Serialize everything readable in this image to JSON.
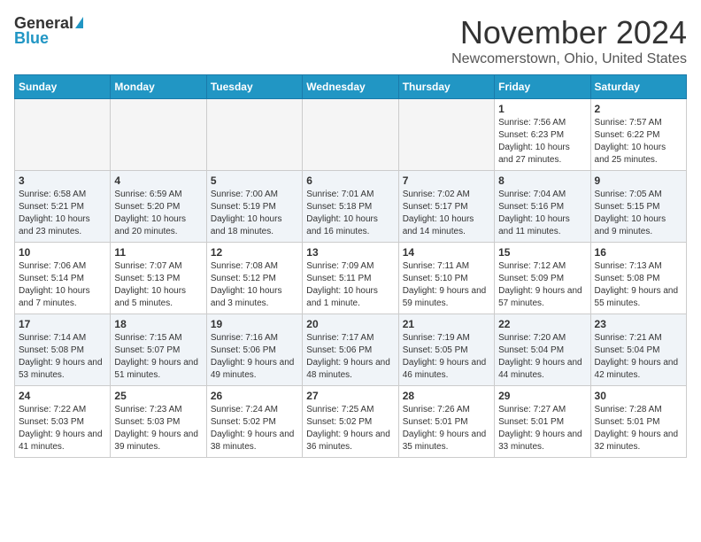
{
  "header": {
    "logo_general": "General",
    "logo_blue": "Blue",
    "month": "November 2024",
    "location": "Newcomerstown, Ohio, United States"
  },
  "days_of_week": [
    "Sunday",
    "Monday",
    "Tuesday",
    "Wednesday",
    "Thursday",
    "Friday",
    "Saturday"
  ],
  "weeks": [
    [
      {
        "day": "",
        "info": ""
      },
      {
        "day": "",
        "info": ""
      },
      {
        "day": "",
        "info": ""
      },
      {
        "day": "",
        "info": ""
      },
      {
        "day": "",
        "info": ""
      },
      {
        "day": "1",
        "info": "Sunrise: 7:56 AM\nSunset: 6:23 PM\nDaylight: 10 hours and 27 minutes."
      },
      {
        "day": "2",
        "info": "Sunrise: 7:57 AM\nSunset: 6:22 PM\nDaylight: 10 hours and 25 minutes."
      }
    ],
    [
      {
        "day": "3",
        "info": "Sunrise: 6:58 AM\nSunset: 5:21 PM\nDaylight: 10 hours and 23 minutes."
      },
      {
        "day": "4",
        "info": "Sunrise: 6:59 AM\nSunset: 5:20 PM\nDaylight: 10 hours and 20 minutes."
      },
      {
        "day": "5",
        "info": "Sunrise: 7:00 AM\nSunset: 5:19 PM\nDaylight: 10 hours and 18 minutes."
      },
      {
        "day": "6",
        "info": "Sunrise: 7:01 AM\nSunset: 5:18 PM\nDaylight: 10 hours and 16 minutes."
      },
      {
        "day": "7",
        "info": "Sunrise: 7:02 AM\nSunset: 5:17 PM\nDaylight: 10 hours and 14 minutes."
      },
      {
        "day": "8",
        "info": "Sunrise: 7:04 AM\nSunset: 5:16 PM\nDaylight: 10 hours and 11 minutes."
      },
      {
        "day": "9",
        "info": "Sunrise: 7:05 AM\nSunset: 5:15 PM\nDaylight: 10 hours and 9 minutes."
      }
    ],
    [
      {
        "day": "10",
        "info": "Sunrise: 7:06 AM\nSunset: 5:14 PM\nDaylight: 10 hours and 7 minutes."
      },
      {
        "day": "11",
        "info": "Sunrise: 7:07 AM\nSunset: 5:13 PM\nDaylight: 10 hours and 5 minutes."
      },
      {
        "day": "12",
        "info": "Sunrise: 7:08 AM\nSunset: 5:12 PM\nDaylight: 10 hours and 3 minutes."
      },
      {
        "day": "13",
        "info": "Sunrise: 7:09 AM\nSunset: 5:11 PM\nDaylight: 10 hours and 1 minute."
      },
      {
        "day": "14",
        "info": "Sunrise: 7:11 AM\nSunset: 5:10 PM\nDaylight: 9 hours and 59 minutes."
      },
      {
        "day": "15",
        "info": "Sunrise: 7:12 AM\nSunset: 5:09 PM\nDaylight: 9 hours and 57 minutes."
      },
      {
        "day": "16",
        "info": "Sunrise: 7:13 AM\nSunset: 5:08 PM\nDaylight: 9 hours and 55 minutes."
      }
    ],
    [
      {
        "day": "17",
        "info": "Sunrise: 7:14 AM\nSunset: 5:08 PM\nDaylight: 9 hours and 53 minutes."
      },
      {
        "day": "18",
        "info": "Sunrise: 7:15 AM\nSunset: 5:07 PM\nDaylight: 9 hours and 51 minutes."
      },
      {
        "day": "19",
        "info": "Sunrise: 7:16 AM\nSunset: 5:06 PM\nDaylight: 9 hours and 49 minutes."
      },
      {
        "day": "20",
        "info": "Sunrise: 7:17 AM\nSunset: 5:06 PM\nDaylight: 9 hours and 48 minutes."
      },
      {
        "day": "21",
        "info": "Sunrise: 7:19 AM\nSunset: 5:05 PM\nDaylight: 9 hours and 46 minutes."
      },
      {
        "day": "22",
        "info": "Sunrise: 7:20 AM\nSunset: 5:04 PM\nDaylight: 9 hours and 44 minutes."
      },
      {
        "day": "23",
        "info": "Sunrise: 7:21 AM\nSunset: 5:04 PM\nDaylight: 9 hours and 42 minutes."
      }
    ],
    [
      {
        "day": "24",
        "info": "Sunrise: 7:22 AM\nSunset: 5:03 PM\nDaylight: 9 hours and 41 minutes."
      },
      {
        "day": "25",
        "info": "Sunrise: 7:23 AM\nSunset: 5:03 PM\nDaylight: 9 hours and 39 minutes."
      },
      {
        "day": "26",
        "info": "Sunrise: 7:24 AM\nSunset: 5:02 PM\nDaylight: 9 hours and 38 minutes."
      },
      {
        "day": "27",
        "info": "Sunrise: 7:25 AM\nSunset: 5:02 PM\nDaylight: 9 hours and 36 minutes."
      },
      {
        "day": "28",
        "info": "Sunrise: 7:26 AM\nSunset: 5:01 PM\nDaylight: 9 hours and 35 minutes."
      },
      {
        "day": "29",
        "info": "Sunrise: 7:27 AM\nSunset: 5:01 PM\nDaylight: 9 hours and 33 minutes."
      },
      {
        "day": "30",
        "info": "Sunrise: 7:28 AM\nSunset: 5:01 PM\nDaylight: 9 hours and 32 minutes."
      }
    ]
  ]
}
